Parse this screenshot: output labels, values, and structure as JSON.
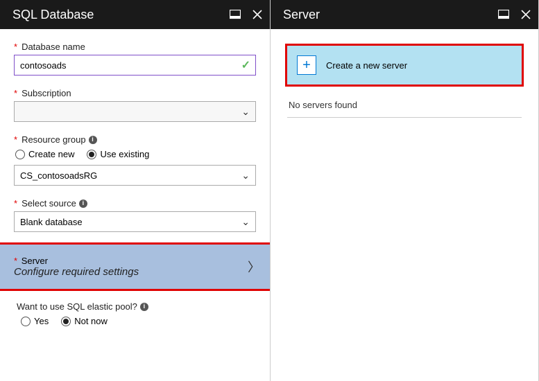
{
  "left": {
    "title": "SQL Database",
    "dbName": {
      "label": "Database name",
      "value": "contosoads"
    },
    "subscription": {
      "label": "Subscription",
      "value": ""
    },
    "resourceGroup": {
      "label": "Resource group",
      "optCreate": "Create new",
      "optExisting": "Use existing",
      "selected": "existing",
      "value": "CS_contosoadsRG"
    },
    "source": {
      "label": "Select source",
      "value": "Blank database"
    },
    "server": {
      "label": "Server",
      "sub": "Configure required settings"
    },
    "elasticPool": {
      "label": "Want to use SQL elastic pool?",
      "optYes": "Yes",
      "optNo": "Not now",
      "selected": "no"
    }
  },
  "right": {
    "title": "Server",
    "createLabel": "Create a new server",
    "emptyMsg": "No servers found"
  }
}
